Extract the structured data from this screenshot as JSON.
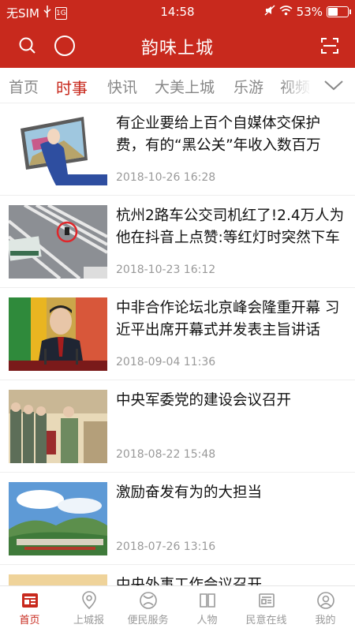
{
  "status": {
    "carrier": "无SIM",
    "sim_label": "1G",
    "time": "14:58",
    "battery": "53%",
    "battery_level": 0.53
  },
  "header": {
    "title": "韵味上城"
  },
  "tabs": [
    "首页",
    "时事",
    "快讯",
    "大美上城",
    "乐游",
    "视频"
  ],
  "active_tab": 1,
  "articles": [
    {
      "title": "有企业要给上百个自媒体交保护费，有的“黑公关”年收入数百万",
      "date": "2018-10-26 16:28",
      "thumb": "illustration-icon"
    },
    {
      "title": "杭州2路车公交司机红了!2.4万人为他在抖音上点赞:等红灯时突然下车",
      "date": "2018-10-23 16:12",
      "thumb": "street-photo-icon"
    },
    {
      "title": "中非合作论坛北京峰会隆重开幕 习近平出席开幕式并发表主旨讲话",
      "date": "2018-09-04 11:36",
      "thumb": "speech-photo-icon"
    },
    {
      "title": "中央军委党的建设会议召开",
      "date": "2018-08-22 15:48",
      "thumb": "meeting-photo-icon"
    },
    {
      "title": "激励奋发有为的大担当",
      "date": "2018-07-26 13:16",
      "thumb": "landscape-photo-icon"
    },
    {
      "title": "中央外事工作会议召开",
      "date": "",
      "thumb": "photo-icon"
    }
  ],
  "bottom_nav": [
    {
      "label": "首页",
      "icon": "news-icon"
    },
    {
      "label": "上城报",
      "icon": "location-icon"
    },
    {
      "label": "便民服务",
      "icon": "service-icon"
    },
    {
      "label": "人物",
      "icon": "book-icon"
    },
    {
      "label": "民意在线",
      "icon": "newspaper-icon"
    },
    {
      "label": "我的",
      "icon": "user-icon"
    }
  ],
  "active_nav": 0,
  "colors": {
    "brand": "#c8291d",
    "inactive": "#999999"
  }
}
